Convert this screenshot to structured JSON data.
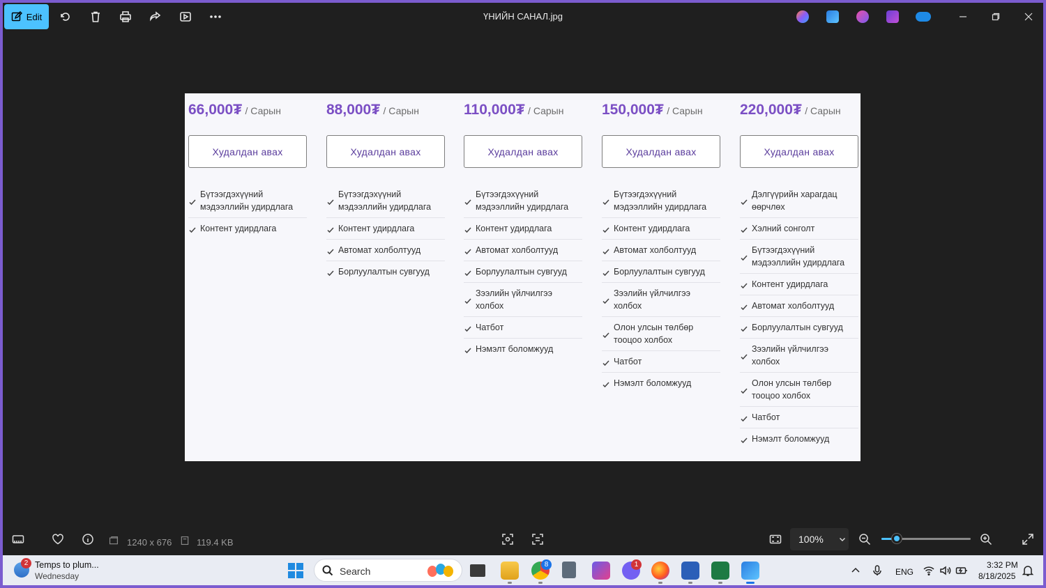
{
  "window": {
    "title": "ҮНИЙН САНАЛ.jpg",
    "edit_label": "Edit"
  },
  "pricing": {
    "unit": "/ Сарын",
    "button_label": "Худалдан авах",
    "plans": [
      {
        "price": "66,000₮",
        "features": [
          "Бүтээгдэхүүний мэдээллийн удирдлага",
          "Контент удирдлага"
        ]
      },
      {
        "price": "88,000₮",
        "features": [
          "Бүтээгдэхүүний мэдээллийн удирдлага",
          "Контент удирдлага",
          "Автомат холболтууд",
          "Борлуулалтын сувгууд"
        ]
      },
      {
        "price": "110,000₮",
        "features": [
          "Бүтээгдэхүүний мэдээллийн удирдлага",
          "Контент удирдлага",
          "Автомат холболтууд",
          "Борлуулалтын сувгууд",
          "Зээлийн үйлчилгээ холбох",
          "Чатбот",
          "Нэмэлт боломжууд"
        ]
      },
      {
        "price": "150,000₮",
        "features": [
          "Бүтээгдэхүүний мэдээллийн удирдлага",
          "Контент удирдлага",
          "Автомат холболтууд",
          "Борлуулалтын сувгууд",
          "Зээлийн үйлчилгээ холбох",
          "Олон улсын төлбөр тооцоо холбох",
          "Чатбот",
          "Нэмэлт боломжууд"
        ]
      },
      {
        "price": "220,000₮",
        "features": [
          "Дэлгүүрийн харагдац өөрчлөх",
          "Хэлний сонголт",
          "Бүтээгдэхүүний мэдээллийн удирдлага",
          "Контент удирдлага",
          "Автомат холболтууд",
          "Борлуулалтын сувгууд",
          "Зээлийн үйлчилгээ холбох",
          "Олон улсын төлбөр тооцоо холбох",
          "Чатбот",
          "Нэмэлт боломжууд"
        ]
      }
    ]
  },
  "statusbar": {
    "dimensions": "1240 x 676",
    "filesize": "119.4 KB",
    "zoom": "100%",
    "zoom_fraction": 0.17
  },
  "taskbar": {
    "weather_badge": "2",
    "weather_line1": "Temps to plum...",
    "weather_line2": "Wednesday",
    "search_placeholder": "Search",
    "chrome_badge": "8",
    "viber_badge": "1",
    "language": "ENG",
    "time": "3:32 PM",
    "date": "8/18/2025"
  },
  "colors": {
    "accent": "#4cc2ff",
    "price": "#7b4fc4",
    "frame": "#7b5ccf"
  }
}
